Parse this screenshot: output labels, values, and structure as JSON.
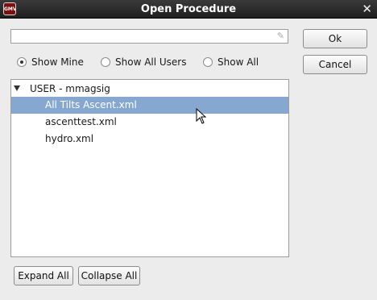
{
  "window": {
    "title": "Open Procedure",
    "app_icon": "GMV"
  },
  "search": {
    "value": "",
    "placeholder": ""
  },
  "filter": {
    "options": [
      {
        "label": "Show Mine",
        "selected": true
      },
      {
        "label": "Show All Users",
        "selected": false
      },
      {
        "label": "Show All",
        "selected": false
      }
    ]
  },
  "tree": {
    "group_label": "USER - mmagsig",
    "items": [
      {
        "label": "All Tilts Ascent.xml",
        "selected": true
      },
      {
        "label": "ascenttest.xml",
        "selected": false
      },
      {
        "label": "hydro.xml",
        "selected": false
      }
    ]
  },
  "buttons": {
    "ok": "Ok",
    "cancel": "Cancel",
    "expand_all": "Expand All",
    "collapse_all": "Collapse All"
  },
  "colors": {
    "titlebar": "#2a2a2a",
    "selection": "#86a7cf"
  },
  "icons": {
    "close": "close-icon",
    "edit": "pencil-icon",
    "expand": "triangle-down-icon",
    "pointer": "mouse-cursor-icon"
  }
}
